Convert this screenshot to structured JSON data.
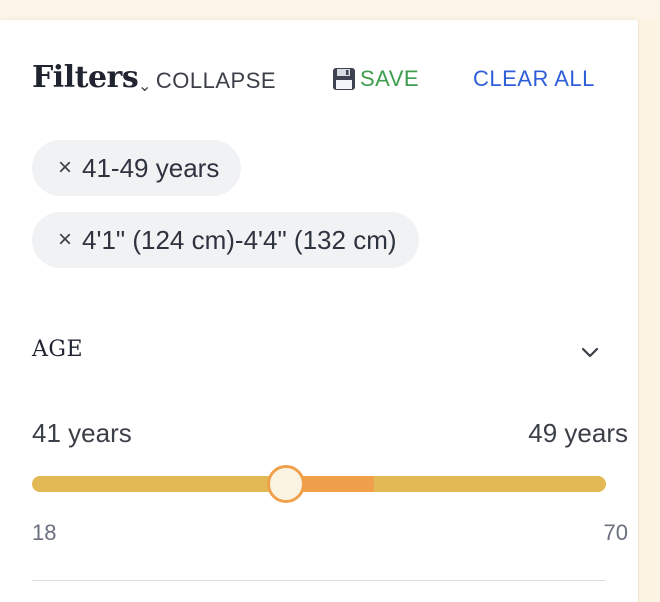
{
  "header": {
    "title": "Filters",
    "collapse_label": "COLLAPSE",
    "save_label": "SAVE",
    "clear_label": "CLEAR ALL"
  },
  "chips": [
    {
      "label": "41-49 years",
      "remove_glyph": "×"
    },
    {
      "label": "4'1\" (124 cm)-4'4\" (132 cm)",
      "remove_glyph": "×"
    }
  ],
  "age_section": {
    "title": "AGE",
    "selected_min_label": "41 years",
    "selected_max_label": "49 years",
    "scale_min": "18",
    "scale_max": "70",
    "range": {
      "min": 18,
      "max": 70,
      "low": 41,
      "high": 49
    }
  },
  "icons": {
    "collapse": "chevron-down-icon",
    "save": "floppy-disk-icon",
    "chip_remove": "close-icon",
    "section_toggle": "chevron-down-icon"
  },
  "colors": {
    "save": "#3f9d4f",
    "clear": "#2f5fd8",
    "track": "#e3b955",
    "fill": "#f0a04b",
    "background": "#fdf6e8"
  }
}
